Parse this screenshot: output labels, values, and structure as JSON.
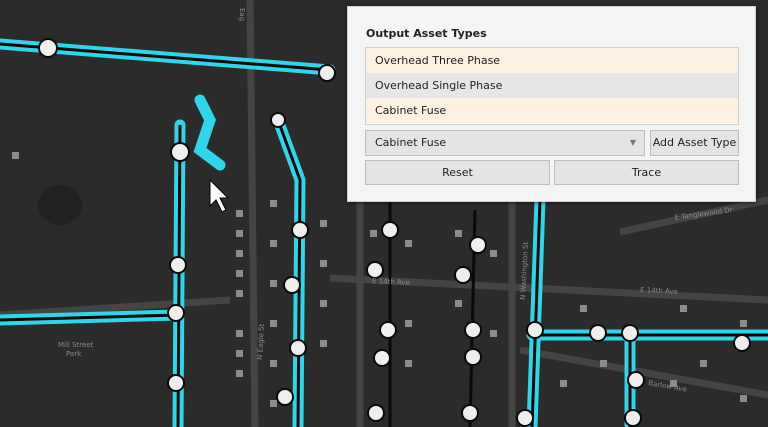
{
  "panel": {
    "title": "Output Asset Types",
    "asset_types": [
      "Overhead Three Phase",
      "Overhead Single Phase",
      "Cabinet Fuse"
    ],
    "dropdown_value": "Cabinet Fuse",
    "add_button": "Add Asset Type",
    "reset_button": "Reset",
    "trace_button": "Trace"
  },
  "map": {
    "labels": {
      "park": "Mill Street",
      "park2": "Park",
      "ave1": "E 14th Ave",
      "ave2": "E 14th Ave",
      "eagle": "N Eagle St",
      "washington": "N Washington St",
      "barlow": "Barlow Ave",
      "tanglewood": "E Tanglewood Dr",
      "top": "Eag"
    },
    "colors": {
      "background": "#2b2b2b",
      "road": "#4a4a4a",
      "trace": "#2fd6ea",
      "line": "#0a0a0a"
    }
  },
  "cursor": "arrow-cursor-icon"
}
